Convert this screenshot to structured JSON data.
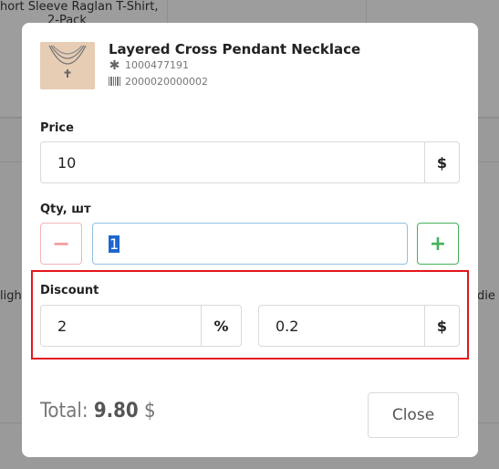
{
  "background": {
    "card_top_title": "hort Sleeve Raglan T-Shirt,",
    "card_top_title_2": "2-Pack",
    "card_top_ellipsis": "...",
    "left_fragment": "ligh",
    "right_fragment": "die"
  },
  "product": {
    "title": "Layered Cross Pendant Necklace",
    "sku": "1000477191",
    "barcode": "2000020000002"
  },
  "price": {
    "label": "Price",
    "value": "10",
    "currency": "$"
  },
  "qty": {
    "label": "Qty, шт",
    "value": "1",
    "minus": "−",
    "plus": "+"
  },
  "discount": {
    "label": "Discount",
    "percent_value": "2",
    "percent_symbol": "%",
    "amount_value": "0.2",
    "amount_symbol": "$"
  },
  "total": {
    "label": "Total:",
    "value": "9.80",
    "currency": "$"
  },
  "actions": {
    "close_label": "Close"
  },
  "colors": {
    "plus_green": "#43b25a",
    "minus_red": "#f3a0a0",
    "highlight_red": "#e3161b",
    "focus_blue": "#8fc1e3"
  }
}
